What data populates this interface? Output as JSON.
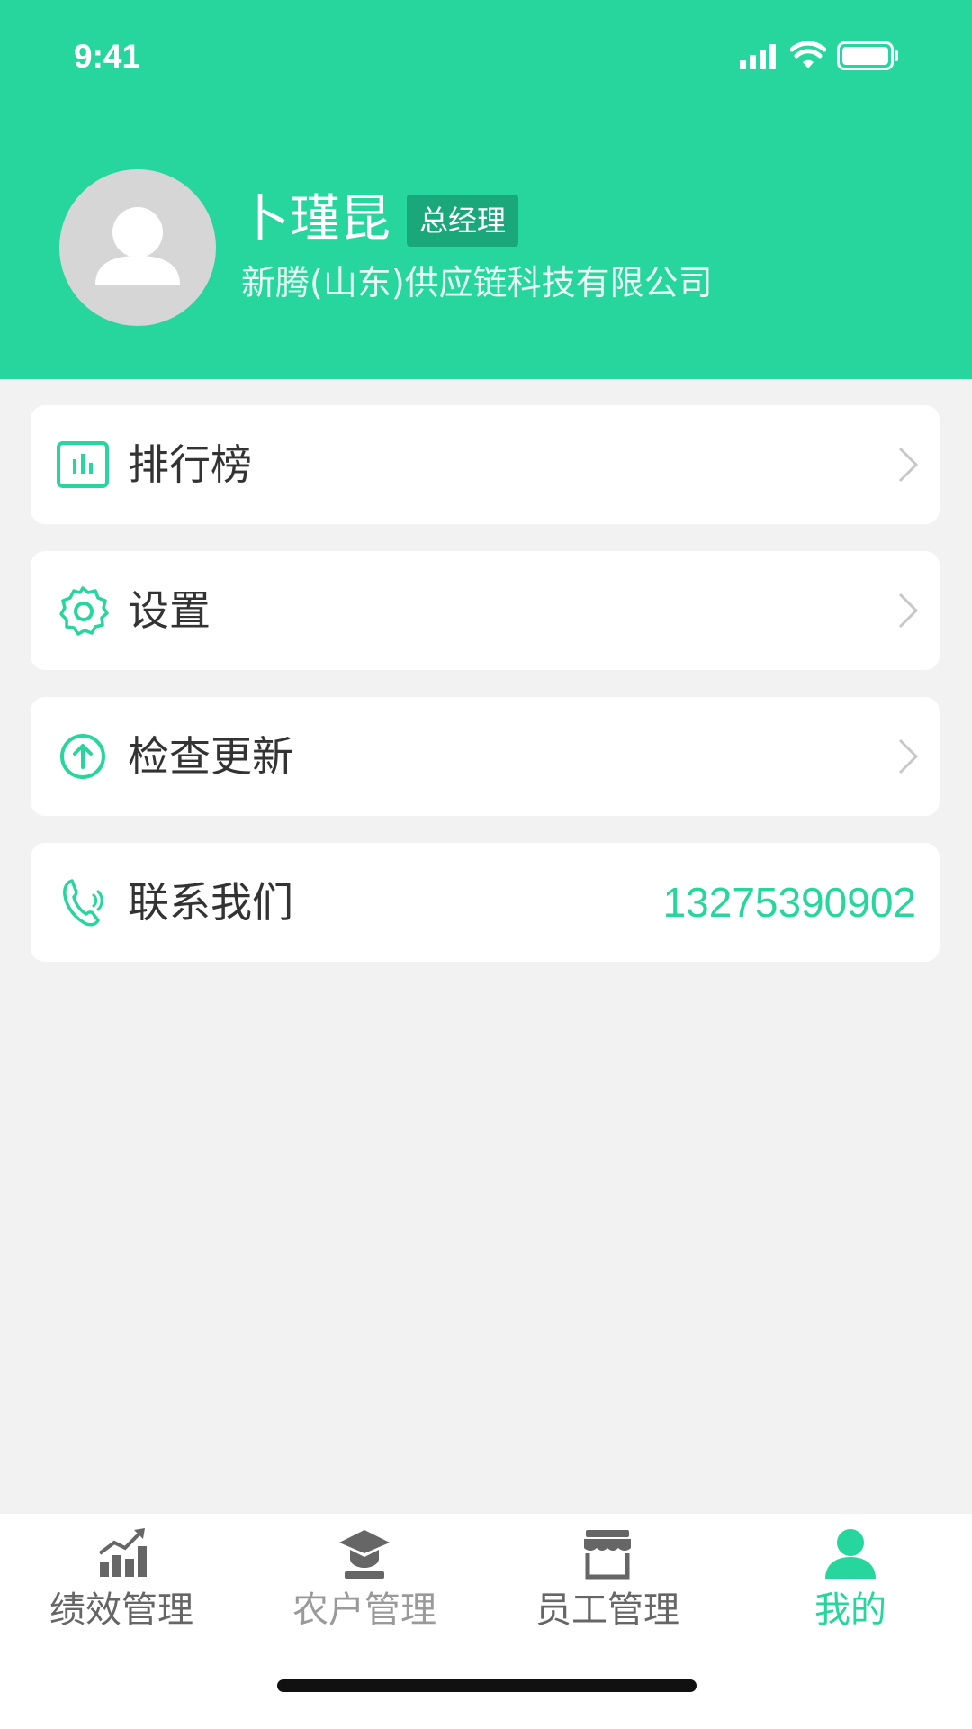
{
  "status_bar": {
    "time": "9:41"
  },
  "profile": {
    "name": "卜瑾昆",
    "role": "总经理",
    "company": "新腾(山东)供应链科技有限公司"
  },
  "menu": {
    "ranking_label": "排行榜",
    "settings_label": "设置",
    "update_label": "检查更新",
    "contact_label": "联系我们",
    "contact_phone": "13275390902"
  },
  "tabbar": {
    "tabs": [
      {
        "label": "绩效管理",
        "icon": "bar-chart-icon"
      },
      {
        "label": "农户管理",
        "icon": "graduation-cap-icon"
      },
      {
        "label": "员工管理",
        "icon": "store-icon"
      },
      {
        "label": "我的",
        "icon": "person-icon"
      }
    ],
    "active_index": 3
  },
  "colors": {
    "brand": "#26d69c",
    "badge": "#1aa77a",
    "background": "#f2f2f2"
  }
}
